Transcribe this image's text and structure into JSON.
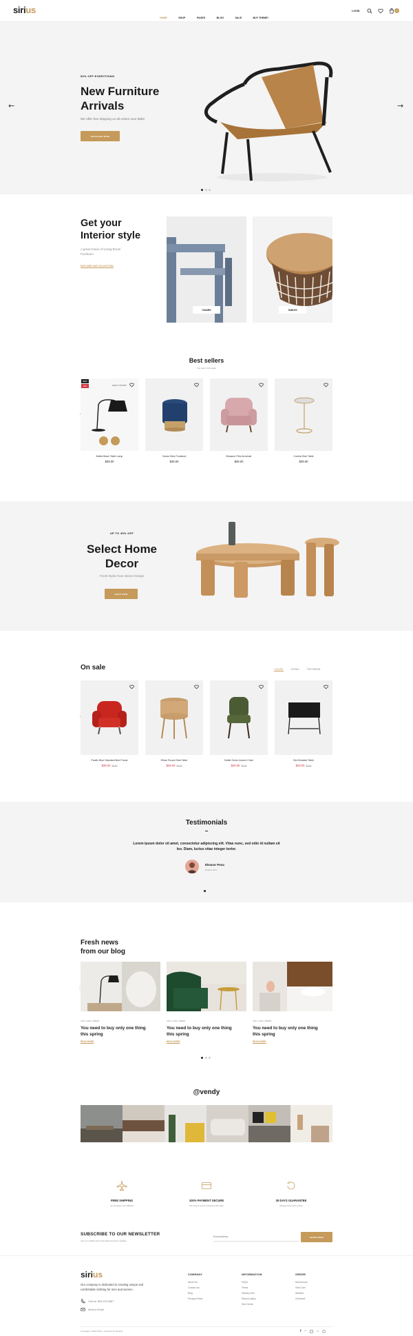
{
  "header": {
    "logo_a": "siri",
    "logo_b": "us",
    "nav": [
      "HOME",
      "SHOP",
      "PAGES",
      "BLOG",
      "SALE",
      "BUY THEME!"
    ],
    "login": "LOGIN",
    "cart_count": "0"
  },
  "hero": {
    "eyebrow": "50% OFF EVERYTHING",
    "title_line1": "New Furniture",
    "title_line2": "Arrivals",
    "subtitle": "We offer free shipping on all orders over $350",
    "button": "DISCOVER NOW"
  },
  "interior": {
    "title_line1": "Get your",
    "title_line2": "Interior style",
    "subtitle_line1": "A great choice of Living Room",
    "subtitle_line2": "Furniture!",
    "link": "EXPLORE OUR COLLECTION",
    "card1_label": "CHAIRS",
    "card2_label": "TABLES"
  },
  "bestsellers": {
    "title": "Best sellers",
    "subtitle": "Top sale in this week",
    "badge_new": "NEW",
    "badge_sale": "-20%",
    "select_options": "SELECT OPTIONS",
    "products": [
      {
        "name": "Mattis Black Table Lamp",
        "price": "$39.00"
      },
      {
        "name": "Ocean Blue Footstool",
        "price": "$39.00"
      },
      {
        "name": "Blossom Pink Armchair",
        "price": "$39.00"
      },
      {
        "name": "Cuenta Side Table",
        "price": "$39.00"
      }
    ]
  },
  "promo": {
    "eyebrow": "UP TO 35% OFF",
    "title_line1": "Select Home",
    "title_line2": "Decor",
    "subtitle": "Fresh Styles from Interior Design",
    "button": "SHOP NOW"
  },
  "onsale": {
    "title": "On sale",
    "tabs": [
      "CHAIRS",
      "SOFAS",
      "TEXTWEAR"
    ],
    "products": [
      {
        "name": "Pacific Blue Standard Bed Frame",
        "price": "$39.00",
        "old": "$0.00"
      },
      {
        "name": "Ethan Round Side Table",
        "price": "$29.00",
        "old": "$0.00"
      },
      {
        "name": "Bottle Green Accent Chair",
        "price": "$29.00",
        "old": "$0.00"
      },
      {
        "name": "Dim Bedside Table",
        "price": "$29.00",
        "old": "$0.00"
      }
    ]
  },
  "testimonials": {
    "title": "Testimonials",
    "quote_line1": "Lorem ipsum dolor sit amet, consectetur adipiscing elit. Vitae nunc, sed odio id nullam sit",
    "quote_line2": "leo. Diam, luctus vitae integer tortor.",
    "name": "Eleanor Pena",
    "role": "Product SUV"
  },
  "blog": {
    "title_line1": "Fresh news",
    "title_line2": "from our blog",
    "posts": [
      {
        "meta": "JAN 6, 2022 / TREND",
        "title_line1": "You need to buy only one thing",
        "title_line2": "this spring",
        "link": "READ MORE"
      },
      {
        "meta": "JAN 6, 2022 / TREND",
        "title_line1": "You need to buy only one thing",
        "title_line2": "this spring",
        "link": "READ MORE"
      },
      {
        "meta": "JAN 6, 2022 / TREND",
        "title_line1": "You need to buy only one thing",
        "title_line2": "this spring",
        "link": "READ MORE"
      }
    ]
  },
  "instagram": {
    "handle": "@vendy"
  },
  "features": [
    {
      "title": "FREE SHIPPING",
      "text": "On all orders over $50.00",
      "icon": "plane-icon"
    },
    {
      "title": "100% PAYMENT SECURE",
      "text": "We ensure secure payment with PEV",
      "icon": "card-icon"
    },
    {
      "title": "30 DAYS GUARANTEE",
      "text": "30 days free return policy",
      "icon": "return-icon"
    }
  ],
  "newsletter": {
    "title": "SUBSCRIBE TO OUR NEWSLETTER",
    "subtitle": "Join our mailing list for the latest and best updates",
    "placeholder": "Email address",
    "button": "SUBSCRIBE"
  },
  "footer": {
    "about_line1": "Our company is dedicated to creating unique and",
    "about_line2": "comfortable clothing for men and women.",
    "phone": "Call us: 800-123-4567",
    "email": "Send a Email",
    "copyright": "Copyright © 2022 Sirius - Powered by Shopify",
    "cols": [
      {
        "title": "COMPANY",
        "items": [
          "About Us",
          "Contact Us",
          "Blog",
          "Privacy Policy"
        ]
      },
      {
        "title": "INFORMATION",
        "items": [
          "FAQ's",
          "Terms",
          "Delivery Info",
          "Refund policy",
          "Size Guide"
        ]
      },
      {
        "title": "ORDER",
        "items": [
          "My Account",
          "View Cart",
          "Wishlist",
          "Checkout"
        ]
      }
    ]
  },
  "colors": {
    "accent": "#c59a5a",
    "sale": "#d2363f",
    "gray_bg": "#f4f4f4"
  }
}
